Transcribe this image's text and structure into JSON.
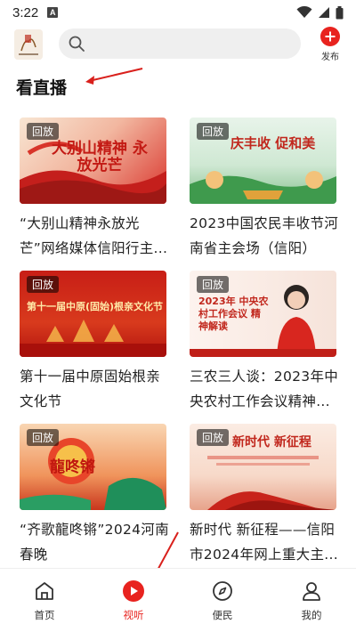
{
  "status_bar": {
    "time": "3:22",
    "notif_badge": "A"
  },
  "header": {
    "search_placeholder": "",
    "publish_label": "发布"
  },
  "section": {
    "title": "看直播"
  },
  "cards": [
    {
      "badge": "回放",
      "title": "“大别山精神永放光芒”网络媒体信阳行主...",
      "thumb_text": "大别山精神 永放光芒"
    },
    {
      "badge": "回放",
      "title": "2023中国农民丰收节河南省主会场（信阳）",
      "thumb_text": "庆丰收 促和美"
    },
    {
      "badge": "回放",
      "title": "第十一届中原固始根亲文化节",
      "thumb_text": "第十一届中原(固始)根亲文化节"
    },
    {
      "badge": "回放",
      "title": "三农三人谈：2023年中央农村工作会议精神...",
      "thumb_text": "2023年 中央农村工作会议 精神解读"
    },
    {
      "badge": "回放",
      "title": "“齐歌龍咚锵”2024河南春晚",
      "thumb_text": "龍咚锵"
    },
    {
      "badge": "回放",
      "title": "新时代 新征程——信阳市2024年网上重大主...",
      "thumb_text": "新时代 新征程"
    }
  ],
  "bottom_nav": [
    {
      "label": "首页",
      "icon": "home-icon",
      "active": false
    },
    {
      "label": "视听",
      "icon": "play-icon",
      "active": true
    },
    {
      "label": "便民",
      "icon": "compass-icon",
      "active": false
    },
    {
      "label": "我的",
      "icon": "profile-icon",
      "active": false
    }
  ],
  "colors": {
    "accent": "#e8231f"
  }
}
